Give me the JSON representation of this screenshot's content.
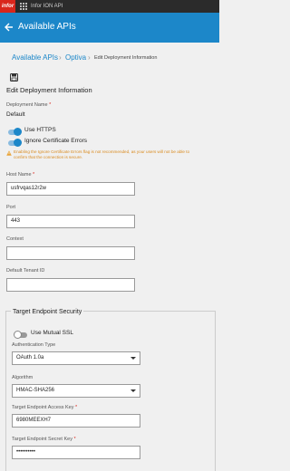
{
  "topbar": {
    "logo": "infor",
    "app_title": "Infor ION API"
  },
  "header": {
    "title": "Available APIs",
    "back_icon": "arrow-left-icon"
  },
  "breadcrumb": {
    "items": [
      "Available APIs",
      "Optiva",
      "Edit Deployment Information"
    ],
    "separator": "›"
  },
  "form": {
    "save_icon": "save-icon",
    "title": "Edit Deployment Information",
    "deployment_name": {
      "label": "Deployment Name",
      "required": "*",
      "value": "Default"
    },
    "use_https": {
      "label": "Use HTTPS",
      "on": true
    },
    "ignore_cert": {
      "label": "Ignore Certificate Errors",
      "on": true
    },
    "warning": "Enabling the Ignore Certificate Errors flag is not recommended, as your users will not be able to confirm that the connection is secure.",
    "host_name": {
      "label": "Host Name",
      "required": "*",
      "value": "usfrvqas12r2w"
    },
    "port": {
      "label": "Port",
      "value": "443"
    },
    "context": {
      "label": "Context",
      "value": ""
    },
    "default_tenant": {
      "label": "Default Tenant ID",
      "value": ""
    }
  },
  "security": {
    "title": "Target Endpoint Security",
    "mutual_ssl": {
      "label": "Use Mutual SSL",
      "on": false
    },
    "auth_type": {
      "label": "Authentication Type",
      "value": "OAuth 1.0a"
    },
    "algorithm": {
      "label": "Algorithm",
      "value": "HMAC-SHA256"
    },
    "access_key": {
      "label": "Target Endpoint Access Key",
      "required": "*",
      "value": "6980MEEXH7"
    },
    "secret_key": {
      "label": "Target Endpoint Secret Key",
      "required": "*",
      "value": "••••••••••"
    }
  },
  "colors": {
    "brand": "#1c87c9",
    "warning": "#d98a1e",
    "logo": "#d9261c"
  }
}
